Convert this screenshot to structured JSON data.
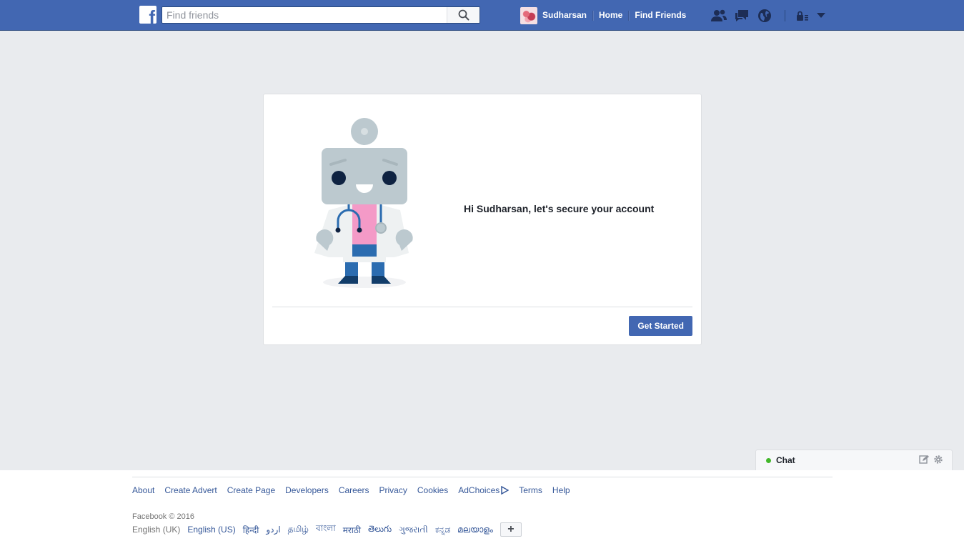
{
  "header": {
    "search_placeholder": "Find friends",
    "user_name": "Sudharsan",
    "home_label": "Home",
    "find_friends_label": "Find Friends",
    "icons": [
      "friend-requests-icon",
      "messages-icon",
      "notifications-icon",
      "privacy-shortcuts-icon",
      "account-menu-icon"
    ]
  },
  "card": {
    "heading": "Hi Sudharsan, let's secure your account",
    "button_label": "Get Started"
  },
  "chat": {
    "label": "Chat",
    "status_color": "#42b72a"
  },
  "footer": {
    "links": [
      "About",
      "Create Advert",
      "Create Page",
      "Developers",
      "Careers",
      "Privacy",
      "Cookies",
      "AdChoices",
      "Terms",
      "Help"
    ],
    "copyright": "Facebook © 2016",
    "current_language": "English (UK)",
    "languages": [
      "English (US)",
      "हिन्दी",
      "اردو",
      "தமிழ்",
      "বাংলা",
      "मराठी",
      "తెలుగు",
      "ગુજરાતી",
      "ಕನ್ನಡ",
      "മലയാളം"
    ],
    "more_languages": "+"
  },
  "colors": {
    "brand_blue": "#4267b2",
    "page_bg": "#e9ebee",
    "link": "#365899"
  }
}
